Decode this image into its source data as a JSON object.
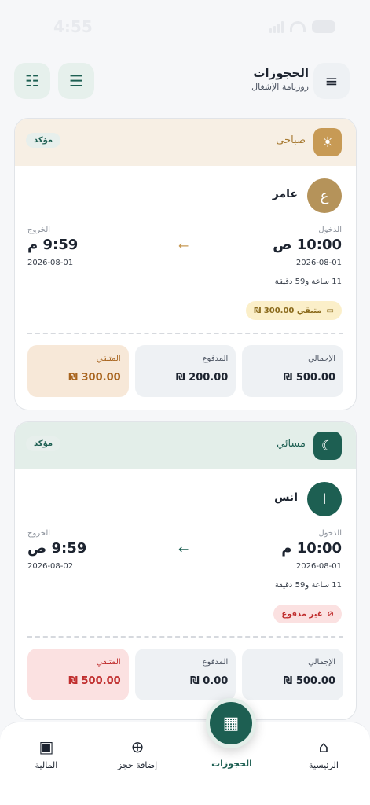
{
  "status_bar": {
    "time": "4:55"
  },
  "header": {
    "title": "الحجوزات",
    "subtitle": "روزنامة الإشغال",
    "menu_icon": "hamburger-icon",
    "list_icon": "list-icon",
    "filter_icon": "sliders-icon"
  },
  "bookings": [
    {
      "shift": "صباحي",
      "status": "مؤكد",
      "avatar_letter": "ع",
      "guest": "عامر",
      "checkin_label": "الدخول",
      "checkin_time": "10:00 ص",
      "checkin_date": "2026-08-01",
      "checkout_label": "الخروج",
      "checkout_time": "9:59 م",
      "checkout_date": "2026-08-01",
      "duration": "11 ساعة و59 دقيقة",
      "payment_badge": "متبقي 300.00 ₪",
      "amounts": {
        "total_label": "الإجمالي",
        "total": "500.00 ₪",
        "paid_label": "المدفوع",
        "paid": "200.00 ₪",
        "remaining_label": "المتبقي",
        "remaining": "300.00 ₪"
      }
    },
    {
      "shift": "مسائي",
      "status": "مؤكد",
      "avatar_letter": "ا",
      "guest": "انس",
      "checkin_label": "الدخول",
      "checkin_time": "10:00 م",
      "checkin_date": "2026-08-01",
      "checkout_label": "الخروج",
      "checkout_time": "9:59 ص",
      "checkout_date": "2026-08-02",
      "duration": "11 ساعة و59 دقيقة",
      "payment_badge": "غير مدفوع",
      "amounts": {
        "total_label": "الإجمالي",
        "total": "500.00 ₪",
        "paid_label": "المدفوع",
        "paid": "0.00 ₪",
        "remaining_label": "المتبقي",
        "remaining": "500.00 ₪"
      }
    }
  ],
  "nav": {
    "home": "الرئيسية",
    "bookings": "الحجوزات",
    "add_booking": "إضافة حجز",
    "finance": "المالية"
  },
  "colors": {
    "primary": "#1d5f52",
    "morning": "#c79a55",
    "danger": "#c02e2e"
  }
}
